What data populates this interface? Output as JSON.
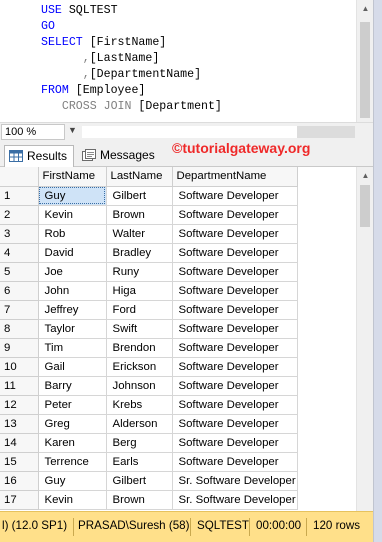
{
  "editor": {
    "lines": [
      [
        {
          "t": "USE ",
          "c": "kw"
        },
        {
          "t": "SQLTEST",
          "c": "plain"
        }
      ],
      [
        {
          "t": "GO",
          "c": "kw"
        }
      ],
      [
        {
          "t": "SELECT ",
          "c": "kw"
        },
        {
          "t": "[FirstName]",
          "c": "plain"
        }
      ],
      [
        {
          "t": "      ,",
          "c": "punct"
        },
        {
          "t": "[LastName]",
          "c": "plain"
        }
      ],
      [
        {
          "t": "      ,",
          "c": "punct"
        },
        {
          "t": "[DepartmentName]",
          "c": "plain"
        }
      ],
      [
        {
          "t": "FROM ",
          "c": "kw"
        },
        {
          "t": "[Employee]",
          "c": "plain"
        }
      ],
      [
        {
          "t": "   CROSS JOIN ",
          "c": "kw-gray"
        },
        {
          "t": "[Department]",
          "c": "plain"
        }
      ]
    ]
  },
  "zoom": {
    "value": "100 %"
  },
  "tabs": {
    "results": "Results",
    "messages": "Messages"
  },
  "watermark": "©tutorialgateway.org",
  "grid": {
    "columns": [
      "FirstName",
      "LastName",
      "DepartmentName"
    ],
    "rows": [
      [
        "1",
        "Guy",
        "Gilbert",
        "Software Developer"
      ],
      [
        "2",
        "Kevin",
        "Brown",
        "Software Developer"
      ],
      [
        "3",
        "Rob",
        "Walter",
        "Software Developer"
      ],
      [
        "4",
        "David",
        "Bradley",
        "Software Developer"
      ],
      [
        "5",
        "Joe",
        "Runy",
        "Software Developer"
      ],
      [
        "6",
        "John",
        "Higa",
        "Software Developer"
      ],
      [
        "7",
        "Jeffrey",
        "Ford",
        "Software Developer"
      ],
      [
        "8",
        "Taylor",
        "Swift",
        "Software Developer"
      ],
      [
        "9",
        "Tim",
        "Brendon",
        "Software Developer"
      ],
      [
        "10",
        "Gail",
        "Erickson",
        "Software Developer"
      ],
      [
        "11",
        "Barry",
        "Johnson",
        "Software Developer"
      ],
      [
        "12",
        "Peter",
        "Krebs",
        "Software Developer"
      ],
      [
        "13",
        "Greg",
        "Alderson",
        "Software Developer"
      ],
      [
        "14",
        "Karen",
        "Berg",
        "Software Developer"
      ],
      [
        "15",
        "Terrence",
        "Earls",
        "Software Developer"
      ],
      [
        "16",
        "Guy",
        "Gilbert",
        "Sr. Software Developer"
      ],
      [
        "17",
        "Kevin",
        "Brown",
        "Sr. Software Developer"
      ]
    ]
  },
  "status": {
    "version": "l) (12.0 SP1)",
    "user": "PRASAD\\Suresh (58)",
    "database": "SQLTEST",
    "time": "00:00:00",
    "rows": "120 rows"
  },
  "colors": {
    "keyword": "#0000ff",
    "status_bar": "#ffe08a",
    "watermark": "#ef2929",
    "selected_cell": "#cfe3f7"
  }
}
